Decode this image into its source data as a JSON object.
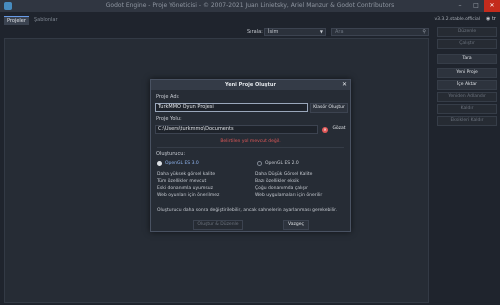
{
  "window": {
    "title": "Godot Engine - Proje Yöneticisi - © 2007-2021 Juan Linietsky, Ariel Manzur & Godot Contributors"
  },
  "tabs": [
    {
      "label": "Projeler"
    },
    {
      "label": "Şablonlar"
    }
  ],
  "version": "v3.3.2.stable.official",
  "language": "tr",
  "sort": {
    "label": "Sırala:",
    "value": "İsim"
  },
  "search": {
    "placeholder": "Ara"
  },
  "sidebar": {
    "items": [
      {
        "label": "Düzenle",
        "enabled": false
      },
      {
        "label": "Çalıştır",
        "enabled": false
      },
      {
        "label": "Tara",
        "enabled": true
      },
      {
        "label": "Yeni Proje",
        "enabled": true
      },
      {
        "label": "İçe Aktar",
        "enabled": true
      },
      {
        "label": "Yeniden Adlandır",
        "enabled": false
      },
      {
        "label": "Kaldır",
        "enabled": false
      },
      {
        "label": "Eksikleri Kaldır",
        "enabled": false
      }
    ]
  },
  "dialog": {
    "title": "Yeni Proje Oluştur",
    "name_label": "Proje Adı:",
    "name_value": "TurkMMO Oyun Projesi",
    "create_folder": "Klasör Oluştur",
    "path_label": "Proje Yolu:",
    "path_value": "C:\\Users\\turkmmo\\Documents",
    "browse": "Gözat",
    "error": "Belirtilen yol mevcut değil.",
    "renderer_label": "Oluşturucu:",
    "renderers": [
      {
        "label": "OpenGL ES 3.0",
        "selected": true,
        "features": [
          "Daha yüksek görsel kalite",
          "Tüm özellikler mevcut",
          "Eski donanımla uyumsuz",
          "Web oyunları için önerilmez"
        ]
      },
      {
        "label": "OpenGL ES 2.0",
        "selected": false,
        "features": [
          "Daha Düşük Görsel Kalite",
          "Bazı özellikler eksik",
          "Çoğu donanımda çalışır",
          "Web uygulamaları için önerilir"
        ]
      }
    ],
    "note": "Oluşturucu daha sonra değiştirilebilir, ancak sahnelerin ayarlanması gerekebilir.",
    "create_button": "Oluştur & Düzenle",
    "cancel_button": "Vazgeç"
  },
  "colors": {
    "accent": "#699ce8",
    "error": "#e05858",
    "background": "#1f242d"
  }
}
